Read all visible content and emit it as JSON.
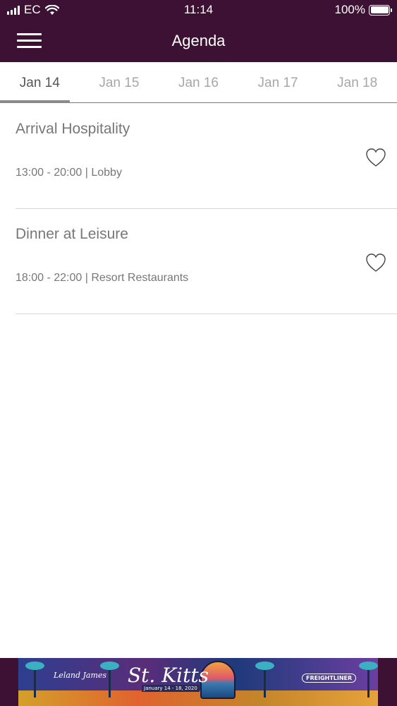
{
  "status_bar": {
    "carrier": "EC",
    "time": "11:14",
    "battery": "100%"
  },
  "nav": {
    "title": "Agenda",
    "menu_icon": "hamburger-menu-icon"
  },
  "tabs": [
    {
      "label": "Jan 14",
      "active": true
    },
    {
      "label": "Jan 15",
      "active": false
    },
    {
      "label": "Jan 16",
      "active": false
    },
    {
      "label": "Jan 17",
      "active": false
    },
    {
      "label": "Jan 18",
      "active": false
    }
  ],
  "events": [
    {
      "title": "Arrival Hospitality",
      "meta": "13:00 - 20:00 | Lobby",
      "favorite": false
    },
    {
      "title": "Dinner at Leisure",
      "meta": "18:00 - 22:00 | Resort Restaurants",
      "favorite": false
    }
  ],
  "banner": {
    "brand_left": "Leland James",
    "destination": "St. Kitts",
    "dates": "January 14 - 18, 2020",
    "sponsor": "FREIGHTLINER"
  },
  "colors": {
    "header": "#3d1133",
    "text_muted": "#777777",
    "tab_inactive": "#a7a7a7"
  }
}
